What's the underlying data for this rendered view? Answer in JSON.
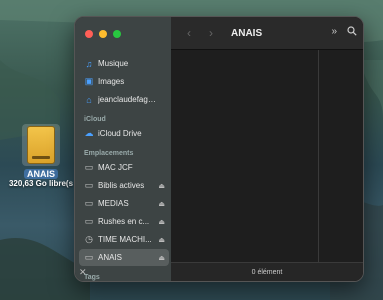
{
  "desktop": {
    "drive_name": "ANAIS",
    "drive_free": "320,63 Go libre(s"
  },
  "window": {
    "title": "ANAIS",
    "status": "0 élément"
  },
  "sidebar": {
    "favorites": [
      {
        "label": "Musique",
        "icon": "music-note-icon"
      },
      {
        "label": "Images",
        "icon": "photo-icon"
      },
      {
        "label": "jeanclaudefaggi...",
        "icon": "home-icon"
      }
    ],
    "icloud_header": "iCloud",
    "icloud": [
      {
        "label": "iCloud Drive",
        "icon": "cloud-icon"
      }
    ],
    "locations_header": "Emplacements",
    "locations": [
      {
        "label": "MAC JCF",
        "icon": "drive-icon"
      },
      {
        "label": "Biblis actives",
        "icon": "drive-icon"
      },
      {
        "label": "MEDIAS",
        "icon": "drive-icon"
      },
      {
        "label": "Rushes en c...",
        "icon": "drive-icon"
      },
      {
        "label": "TIME MACHI...",
        "icon": "time-machine-icon"
      },
      {
        "label": "ANAIS",
        "icon": "drive-icon"
      }
    ],
    "tags_header": "Tags"
  },
  "colors": {
    "accent": "#4aa0ff",
    "drive_yellow": "#f3c44a"
  }
}
